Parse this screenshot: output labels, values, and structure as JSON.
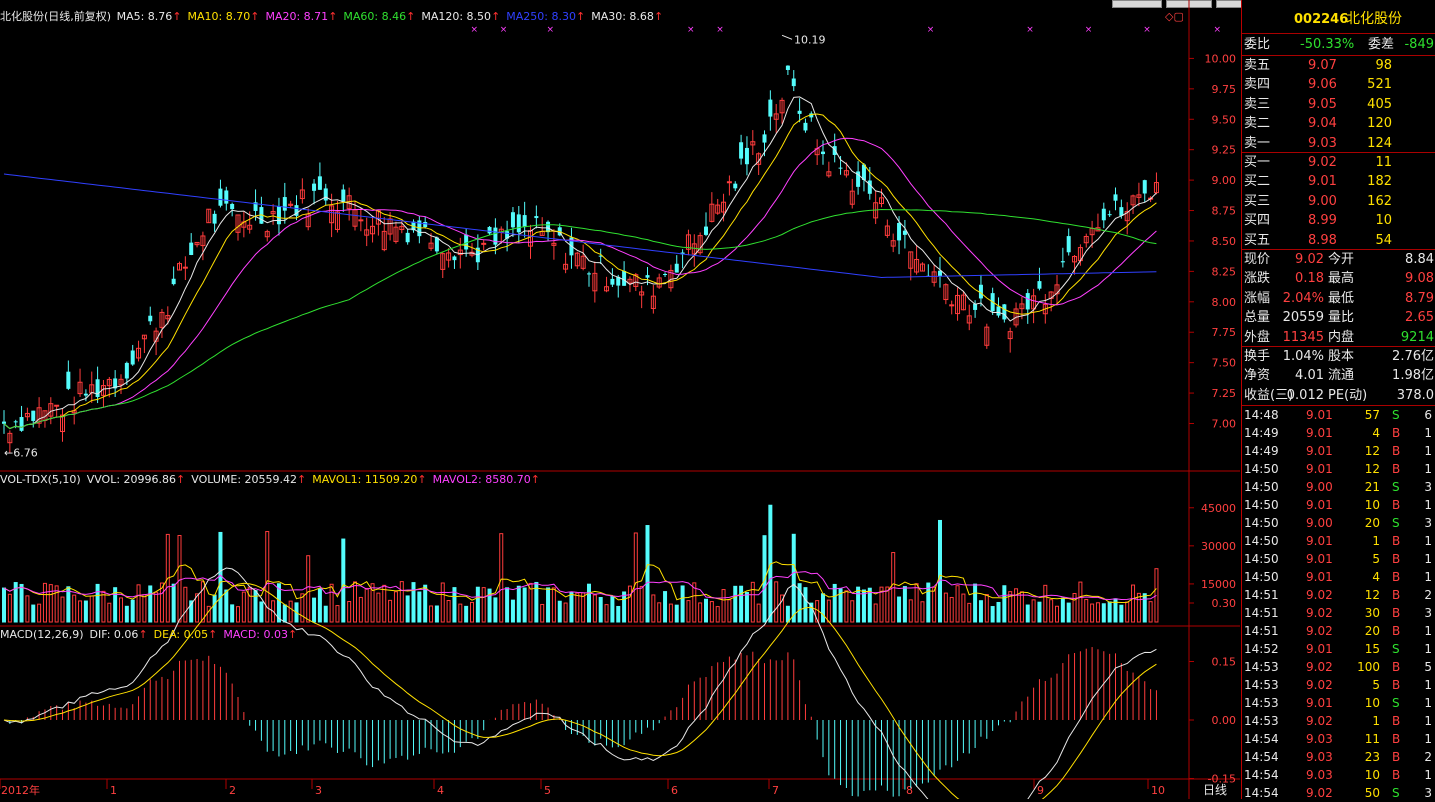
{
  "kline": {
    "legend": {
      "title": "北化股份(日线,前复权)",
      "items": [
        {
          "text": "MA5: 8.76",
          "color": "#e8e8e8"
        },
        {
          "text": "MA10: 8.70",
          "color": "#ffe000"
        },
        {
          "text": "MA20: 8.71",
          "color": "#ff40ff"
        },
        {
          "text": "MA60: 8.46",
          "color": "#30e030"
        },
        {
          "text": "MA120: 8.50",
          "color": "#e8e8e8"
        },
        {
          "text": "MA250: 8.30",
          "color": "#3040ff"
        },
        {
          "text": "MA30: 8.68",
          "color": "#e8e8e8"
        }
      ]
    },
    "y_ticks": [
      "10.00",
      "9.75",
      "9.50",
      "9.25",
      "9.00",
      "8.75",
      "8.50",
      "8.25",
      "8.00",
      "7.75",
      "7.50",
      "7.25",
      "7.00"
    ],
    "high_label": "10.19",
    "low_label": "6.76"
  },
  "volume": {
    "legend": [
      {
        "text": "VOL-TDX(5,10)",
        "color": "#e8e8e8"
      },
      {
        "text": "VVOL: 20996.86",
        "color": "#e8e8e8"
      },
      {
        "text": "VOLUME: 20559.42",
        "color": "#e8e8e8"
      },
      {
        "text": "MAVOL1: 11509.20",
        "color": "#ffe000"
      },
      {
        "text": "MAVOL2: 8580.70",
        "color": "#ff40ff"
      }
    ],
    "y_ticks": [
      "45000",
      "30000",
      "15000"
    ]
  },
  "macd": {
    "legend": [
      {
        "text": "MACD(12,26,9)",
        "color": "#e8e8e8"
      },
      {
        "text": "DIF: 0.06",
        "color": "#e8e8e8"
      },
      {
        "text": "DEA: 0.05",
        "color": "#ffe000"
      },
      {
        "text": "MACD: 0.03",
        "color": "#ff40ff"
      }
    ],
    "y_ticks": [
      "0.30",
      "0.15",
      "0.00",
      "-0.15"
    ]
  },
  "x_axis": {
    "labels": [
      "2012年",
      "1",
      "2",
      "3",
      "4",
      "5",
      "6",
      "7",
      "8",
      "9",
      "10"
    ],
    "period": "日线"
  },
  "chart_data": {
    "type": "candlestick",
    "ylim": [
      6.7,
      10.25
    ],
    "markers": [
      {
        "label": "10.19",
        "value": 10.19
      },
      {
        "label": "6.76",
        "value": 6.76
      }
    ]
  },
  "quote": {
    "code": "002246",
    "name": "北化股份",
    "webi_label": "委比",
    "webi_value": "-50.33%",
    "weicha_label": "委差",
    "weicha_value": "-849",
    "asks": [
      {
        "label": "卖五",
        "price": "9.07",
        "vol": "98"
      },
      {
        "label": "卖四",
        "price": "9.06",
        "vol": "521"
      },
      {
        "label": "卖三",
        "price": "9.05",
        "vol": "405"
      },
      {
        "label": "卖二",
        "price": "9.04",
        "vol": "120"
      },
      {
        "label": "卖一",
        "price": "9.03",
        "vol": "124"
      }
    ],
    "bids": [
      {
        "label": "买一",
        "price": "9.02",
        "vol": "11"
      },
      {
        "label": "买二",
        "price": "9.01",
        "vol": "182"
      },
      {
        "label": "买三",
        "price": "9.00",
        "vol": "162"
      },
      {
        "label": "买四",
        "price": "8.99",
        "vol": "10"
      },
      {
        "label": "买五",
        "price": "8.98",
        "vol": "54"
      }
    ],
    "stats": [
      {
        "l1": "现价",
        "v1": "9.02",
        "c1": "red",
        "l2": "今开",
        "v2": "8.84",
        "c2": "white"
      },
      {
        "l1": "涨跌",
        "v1": "0.18",
        "c1": "red",
        "l2": "最高",
        "v2": "9.08",
        "c2": "red"
      },
      {
        "l1": "涨幅",
        "v1": "2.04%",
        "c1": "red",
        "l2": "最低",
        "v2": "8.79",
        "c2": "red"
      },
      {
        "l1": "总量",
        "v1": "20559",
        "c1": "white",
        "l2": "量比",
        "v2": "2.65",
        "c2": "red"
      },
      {
        "l1": "外盘",
        "v1": "11345",
        "c1": "red",
        "l2": "内盘",
        "v2": "9214",
        "c2": "green"
      }
    ],
    "stats2": [
      {
        "l1": "换手",
        "v1": "1.04%",
        "l2": "股本",
        "v2": "2.76亿"
      },
      {
        "l1": "净资",
        "v1": "4.01",
        "l2": "流通",
        "v2": "1.98亿"
      },
      {
        "l1": "收益(三)",
        "v1": "0.012",
        "l2": "PE(动)",
        "v2": "378.0"
      }
    ],
    "ticks": [
      {
        "time": "14:48",
        "price": "9.01",
        "vol": "57",
        "bs": "S",
        "n": "6"
      },
      {
        "time": "14:49",
        "price": "9.01",
        "vol": "4",
        "bs": "B",
        "n": "1"
      },
      {
        "time": "14:49",
        "price": "9.01",
        "vol": "12",
        "bs": "B",
        "n": "1"
      },
      {
        "time": "14:50",
        "price": "9.01",
        "vol": "12",
        "bs": "B",
        "n": "1"
      },
      {
        "time": "14:50",
        "price": "9.00",
        "vol": "21",
        "bs": "S",
        "n": "3"
      },
      {
        "time": "14:50",
        "price": "9.01",
        "vol": "10",
        "bs": "B",
        "n": "1"
      },
      {
        "time": "14:50",
        "price": "9.00",
        "vol": "20",
        "bs": "S",
        "n": "3"
      },
      {
        "time": "14:50",
        "price": "9.01",
        "vol": "1",
        "bs": "B",
        "n": "1"
      },
      {
        "time": "14:50",
        "price": "9.01",
        "vol": "5",
        "bs": "B",
        "n": "1"
      },
      {
        "time": "14:50",
        "price": "9.01",
        "vol": "4",
        "bs": "B",
        "n": "1"
      },
      {
        "time": "14:51",
        "price": "9.02",
        "vol": "12",
        "bs": "B",
        "n": "2"
      },
      {
        "time": "14:51",
        "price": "9.02",
        "vol": "30",
        "bs": "B",
        "n": "3"
      },
      {
        "time": "14:51",
        "price": "9.02",
        "vol": "20",
        "bs": "B",
        "n": "1"
      },
      {
        "time": "14:52",
        "price": "9.01",
        "vol": "15",
        "bs": "S",
        "n": "1"
      },
      {
        "time": "14:53",
        "price": "9.02",
        "vol": "100",
        "bs": "B",
        "n": "5"
      },
      {
        "time": "14:53",
        "price": "9.02",
        "vol": "5",
        "bs": "B",
        "n": "1"
      },
      {
        "time": "14:53",
        "price": "9.01",
        "vol": "10",
        "bs": "S",
        "n": "1"
      },
      {
        "time": "14:53",
        "price": "9.02",
        "vol": "1",
        "bs": "B",
        "n": "1"
      },
      {
        "time": "14:54",
        "price": "9.03",
        "vol": "11",
        "bs": "B",
        "n": "1"
      },
      {
        "time": "14:54",
        "price": "9.03",
        "vol": "23",
        "bs": "B",
        "n": "2"
      },
      {
        "time": "14:54",
        "price": "9.03",
        "vol": "10",
        "bs": "B",
        "n": "1"
      },
      {
        "time": "14:54",
        "price": "9.02",
        "vol": "50",
        "bs": "S",
        "n": "3"
      }
    ]
  }
}
